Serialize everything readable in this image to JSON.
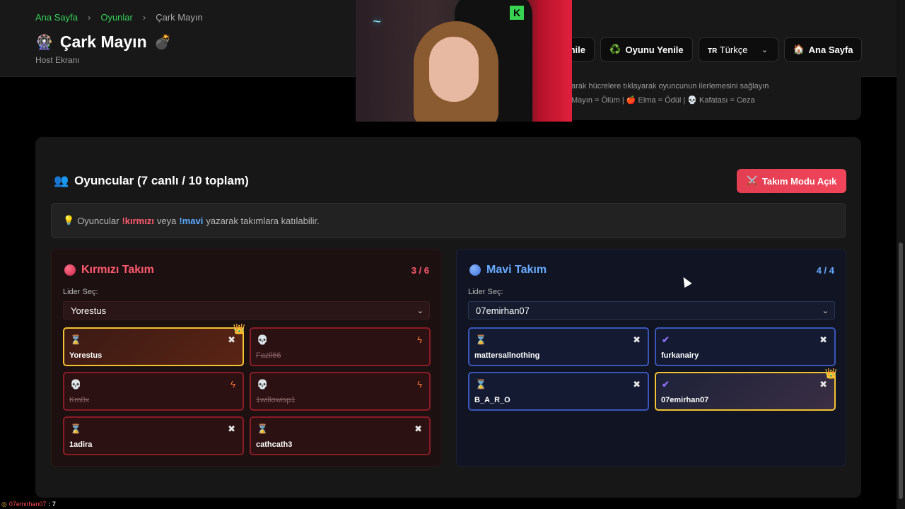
{
  "breadcrumb": {
    "home": "Ana Sayfa",
    "games": "Oyunlar",
    "current": "Çark Mayın"
  },
  "header": {
    "title": "Çark Mayın",
    "subtitle": "Host Ekranı",
    "title_icon": "ferris-wheel-icon",
    "bomb_icon": "bomb-icon"
  },
  "actions": {
    "partial_label": "nile",
    "renew_label": "Oyunu Yenile",
    "renew_icon": "♻️",
    "language_code": "TR",
    "language_label": "Türkçe",
    "home_label": "Ana Sayfa",
    "home_icon": "🏠"
  },
  "info": {
    "line1": "arak hücrelere tıklayarak oyuncunun ilerlemesini sağlayın",
    "line2": "Mayın = Ölüm | 🍎 Elma = Ödül | 💀 Kafatası = Ceza"
  },
  "players": {
    "icon": "👥",
    "title": "Oyuncular (7 canlı / 10 toplam)",
    "team_mode_icon": "⚔️",
    "team_mode_label": "Takım Modu Açık",
    "hint_pre": "Oyuncular",
    "hint_red": "!kırmızı",
    "hint_mid": "veya",
    "hint_blue": "!mavi",
    "hint_post": "yazarak takımlara katılabilir.",
    "hint_icon": "💡"
  },
  "red_team": {
    "name": "Kırmızı Takım",
    "count": "3 / 6",
    "leader_label": "Lider Seç:",
    "leader": "Yorestus",
    "players": [
      {
        "name": "Yorestus",
        "status": "⌛",
        "action": "✖",
        "leader": true,
        "dead": false
      },
      {
        "name": "Fazil66",
        "status": "💀",
        "action": "ϟ",
        "leader": false,
        "dead": true
      },
      {
        "name": "Km0x",
        "status": "💀",
        "action": "ϟ",
        "leader": false,
        "dead": true
      },
      {
        "name": "1willowisp1",
        "status": "💀",
        "action": "ϟ",
        "leader": false,
        "dead": true
      },
      {
        "name": "1adira",
        "status": "⌛",
        "action": "✖",
        "leader": false,
        "dead": false
      },
      {
        "name": "cathcath3",
        "status": "⌛",
        "action": "✖",
        "leader": false,
        "dead": false
      }
    ]
  },
  "blue_team": {
    "name": "Mavi Takım",
    "count": "4 / 4",
    "leader_label": "Lider Seç:",
    "leader": "07emirhan07",
    "players": [
      {
        "name": "mattersallnothing",
        "status": "⌛",
        "action": "✖",
        "leader": false,
        "dead": false
      },
      {
        "name": "furkanairy",
        "status": "✔",
        "action": "✖",
        "leader": false,
        "dead": false
      },
      {
        "name": "B_A_R_O",
        "status": "⌛",
        "action": "✖",
        "leader": false,
        "dead": false
      },
      {
        "name": "07emirhan07",
        "status": "✔",
        "action": "✖",
        "leader": true,
        "dead": false
      }
    ]
  },
  "crown": "👑",
  "chat": {
    "badge": "◎",
    "user": "07emirhan07",
    "message": ": 7"
  },
  "colors": {
    "red_accent": "#ff5a6e",
    "blue_accent": "#68aaff",
    "leader_border": "#f2c230",
    "breadcrumb_link": "#34d058"
  }
}
